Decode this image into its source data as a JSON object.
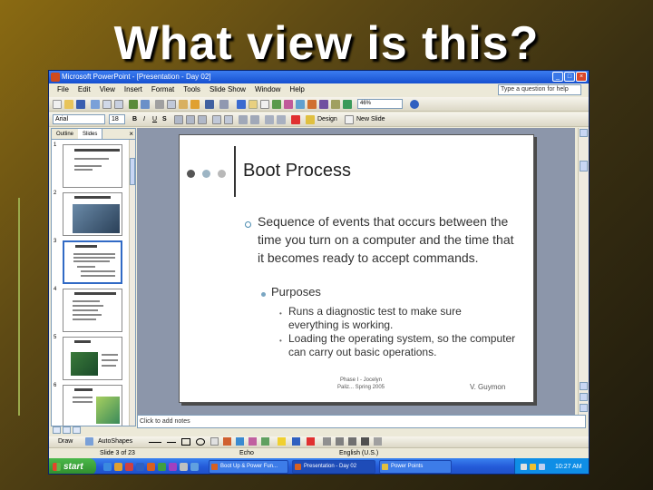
{
  "heading": "What view is this?",
  "window": {
    "title": "Microsoft PowerPoint - [Presentation - Day 02]",
    "menu": [
      "File",
      "Edit",
      "View",
      "Insert",
      "Format",
      "Tools",
      "Slide Show",
      "Window",
      "Help"
    ],
    "help_placeholder": "Type a question for help",
    "zoom": "46%",
    "font": "Arial",
    "font_size": "18",
    "design_label": "Design",
    "new_slide_label": "New Slide",
    "window_buttons": [
      "_",
      "□",
      "×"
    ]
  },
  "pane": {
    "tabs": [
      "Outline",
      "Slides"
    ],
    "close": "×",
    "thumbnails": [
      1,
      2,
      3,
      4,
      5,
      6
    ]
  },
  "slide": {
    "title": "Boot Process",
    "bullet1": "Sequence of events that occurs between the time you turn on a computer and the time that it becomes ready to accept commands.",
    "bullet2": "Purposes",
    "bullet3": "Runs a diagnostic test to make sure everything is working.",
    "bullet4": "Loading the operating system, so the computer can carry out basic operations.",
    "sub_mark": "•",
    "footer_center": "Phase I - Jocelyn Paliz... Spring 2005",
    "footer_right": "V. Guymon"
  },
  "notes_placeholder": "Click to add notes",
  "drawing_toolbar": {
    "draw": "Draw",
    "autoshapes": "AutoShapes"
  },
  "status": {
    "slide": "Slide 3 of 23",
    "design": "Echo",
    "language": "English (U.S.)"
  },
  "taskbar": {
    "start": "start",
    "tasks": [
      "Boot Up & Power Fun...",
      "Presentation - Day 02",
      "Power Points"
    ],
    "clock": "10:27 AM"
  },
  "colors": {
    "accent_dot_1": "#555555",
    "accent_dot_2": "#9db5c4",
    "accent_dot_3": "#b9b9b9",
    "titlebar": "#1650d0",
    "start": "#2e8a2c"
  }
}
